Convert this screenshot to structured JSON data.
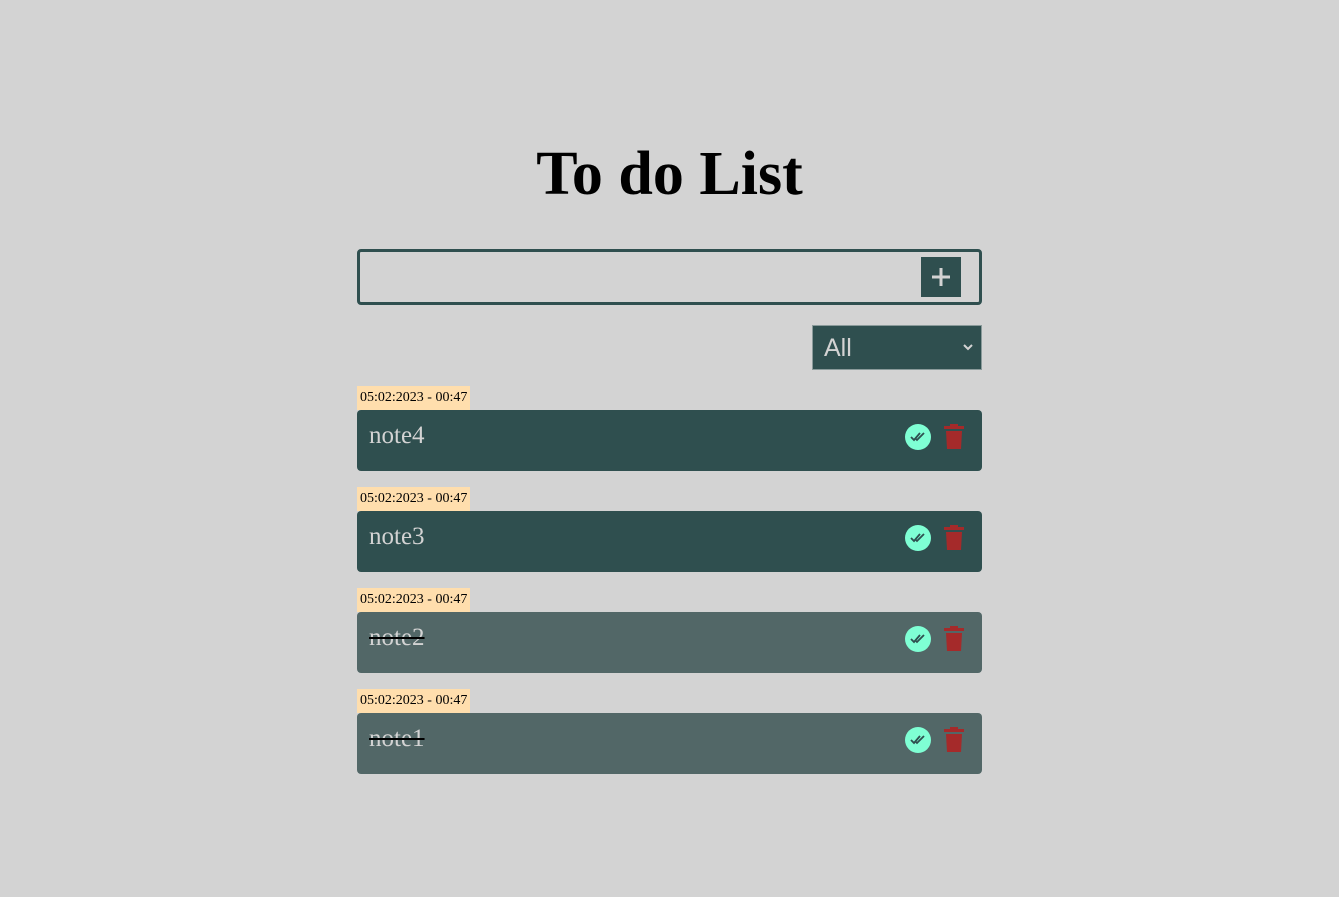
{
  "header": {
    "title": "To do List"
  },
  "add_form": {
    "input_value": "",
    "add_icon": "plus-icon"
  },
  "filter": {
    "selected": "All",
    "icon": "chevron-down-icon"
  },
  "todos": [
    {
      "timestamp": "05:02:2023 - 00:47",
      "text": "note4",
      "completed": false
    },
    {
      "timestamp": "05:02:2023 - 00:47",
      "text": "note3",
      "completed": false
    },
    {
      "timestamp": "05:02:2023 - 00:47",
      "text": "note2",
      "completed": true
    },
    {
      "timestamp": "05:02:2023 - 00:47",
      "text": "note1",
      "completed": true
    }
  ],
  "icons": {
    "complete": "double-check-icon",
    "delete": "trash-icon"
  },
  "colors": {
    "background": "#d3d3d3",
    "accent": "#2f4f4f",
    "completed_card": "#526767",
    "check_button": "#7fffd4",
    "delete_icon": "#a52a2a",
    "timestamp_bg": "#ffdead"
  }
}
